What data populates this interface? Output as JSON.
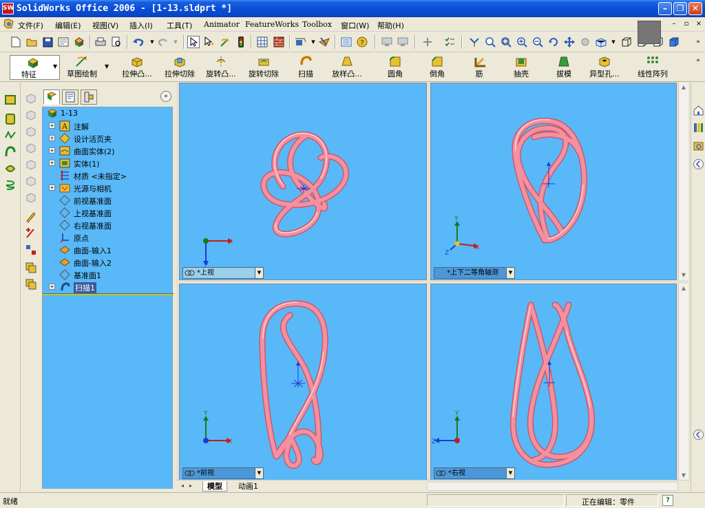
{
  "window": {
    "title": "SolidWorks Office 2006 - [1-13.sldprt *]",
    "logo": "SW",
    "controls": [
      "minimize-icon",
      "restore-icon",
      "close-icon"
    ]
  },
  "menu": {
    "items": [
      "文件(F)",
      "编辑(E)",
      "视图(V)",
      "插入(I)",
      "工具(T)",
      "Animator",
      "FeatureWorks",
      "Toolbox",
      "窗口(W)",
      "帮助(H)"
    ],
    "mdi_controls": [
      "–",
      "▫",
      "×"
    ]
  },
  "toolbar2": {
    "buttons": [
      "特征",
      "草图绘制",
      "拉伸凸...",
      "拉伸切除",
      "旋转凸...",
      "旋转切除",
      "扫描",
      "放样凸...",
      "圆角",
      "倒角",
      "筋",
      "抽壳",
      "拔模",
      "异型孔...",
      "线性阵列"
    ]
  },
  "feature_tree": {
    "tabs": [
      "feature-manager-icon",
      "property-manager-icon",
      "configuration-manager-icon"
    ],
    "collapse_label": "»",
    "root": "1-13",
    "items": [
      {
        "label": "注解",
        "icon": "annotation-icon",
        "expandable": true
      },
      {
        "label": "设计活页夹",
        "icon": "design-binder-icon",
        "expandable": true
      },
      {
        "label": "曲面实体(2)",
        "icon": "surface-body-icon",
        "expandable": true
      },
      {
        "label": "实体(1)",
        "icon": "solid-body-icon",
        "expandable": true
      },
      {
        "label": "材质 <未指定>",
        "icon": "material-icon",
        "expandable": false
      },
      {
        "label": "光源与相机",
        "icon": "lights-cameras-icon",
        "expandable": true
      },
      {
        "label": "前视基准面",
        "icon": "plane-icon",
        "expandable": false
      },
      {
        "label": "上视基准面",
        "icon": "plane-icon",
        "expandable": false
      },
      {
        "label": "右视基准面",
        "icon": "plane-icon",
        "expandable": false
      },
      {
        "label": "原点",
        "icon": "origin-icon",
        "expandable": false
      },
      {
        "label": "曲面-输入1",
        "icon": "imported-surface-icon",
        "expandable": false
      },
      {
        "label": "曲面-输入2",
        "icon": "imported-surface-icon",
        "expandable": false
      },
      {
        "label": "基准面1",
        "icon": "plane-icon",
        "expandable": false
      },
      {
        "label": "扫描1",
        "icon": "sweep-icon",
        "expandable": true
      }
    ]
  },
  "viewports": [
    {
      "id": "top",
      "label": "*上视",
      "axes": [
        "X",
        "Z"
      ]
    },
    {
      "id": "trimetric",
      "label": "*上下二等角轴测",
      "axes": [
        "Y",
        "X",
        "Z"
      ]
    },
    {
      "id": "front",
      "label": "*前视",
      "axes": [
        "Y",
        "X"
      ]
    },
    {
      "id": "right",
      "label": "*右视",
      "axes": [
        "Y",
        "Z"
      ]
    }
  ],
  "tabs": {
    "items": [
      "模型",
      "动画1"
    ],
    "nav": [
      "◂",
      "▸"
    ]
  },
  "status": {
    "left": "就绪",
    "right": "正在编辑：零件",
    "help": "?"
  },
  "colors": {
    "viewport_bg": "#58b8f8",
    "tube": "#f48a98",
    "titlebar": "#0a4fd8"
  }
}
